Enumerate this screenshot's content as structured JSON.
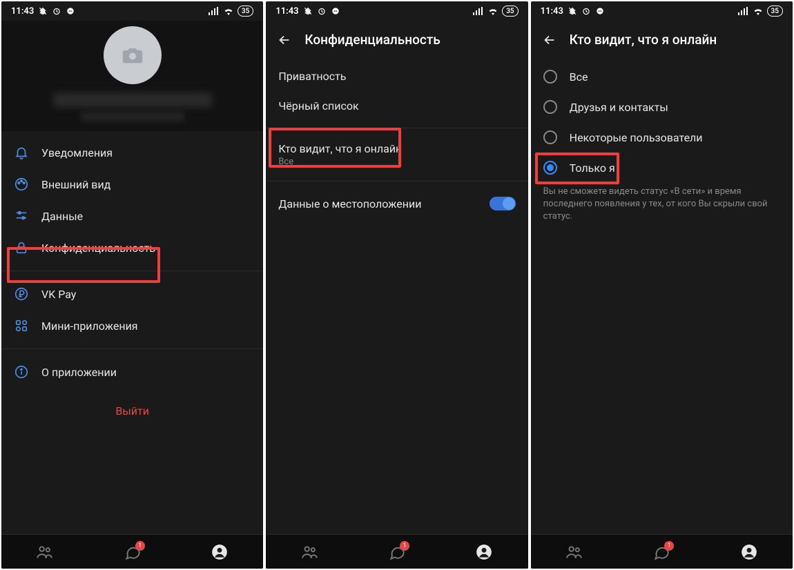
{
  "status": {
    "time": "11:43",
    "battery": "35"
  },
  "screen1": {
    "menu": {
      "notifications": "Уведомления",
      "appearance": "Внешний вид",
      "data": "Данные",
      "privacy": "Конфиденциальность",
      "vkpay": "VK Pay",
      "miniapps": "Мини-приложения",
      "about": "О приложении"
    },
    "logout": "Выйти"
  },
  "screen2": {
    "title": "Конфиденциальность",
    "items": {
      "privacy": "Приватность",
      "blacklist": "Чёрный список",
      "who_sees_online": "Кто видит, что я онлайн",
      "who_sees_online_sub": "Все",
      "location": "Данные о местоположении"
    }
  },
  "screen3": {
    "title": "Кто видит, что я онлайн",
    "options": {
      "all": "Все",
      "friends": "Друзья и контакты",
      "some": "Некоторые пользователи",
      "only_me": "Только я"
    },
    "hint": "Вы не сможете видеть статус «В сети» и время последнего появления у тех, от кого Вы скрыли свой статус."
  },
  "nav": {
    "badge": "1"
  }
}
